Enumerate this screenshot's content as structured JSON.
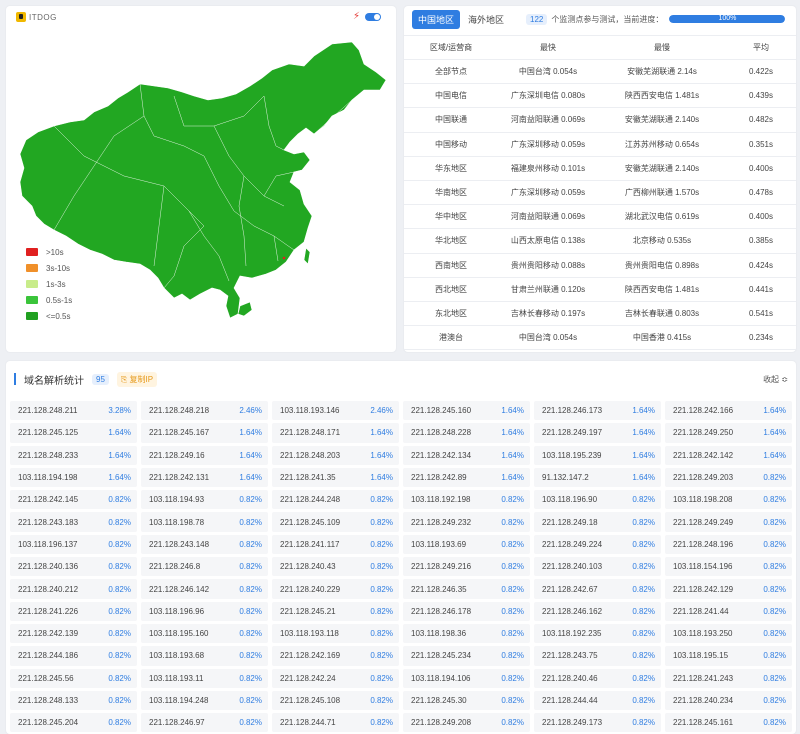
{
  "brand": {
    "name": "ITDOG"
  },
  "legend": [
    {
      "label": ">10s",
      "color": "#e02020"
    },
    {
      "label": "3s-10s",
      "color": "#f0902a"
    },
    {
      "label": "1s-3s",
      "color": "#c8ec8a"
    },
    {
      "label": "0.5s-1s",
      "color": "#3ac43a"
    },
    {
      "label": "<=0.5s",
      "color": "#20a020"
    }
  ],
  "map_fill_color": "#22a722",
  "stats": {
    "tabs": [
      "中国地区",
      "海外地区"
    ],
    "active_tab": "中国地区",
    "node_count": "122",
    "progress_text": "个监测点参与测试，当前进度：",
    "progress_label": "100%",
    "progress_value": 1.0,
    "columns": [
      "区域/运营商",
      "最快",
      "最慢",
      "平均"
    ],
    "rows": [
      [
        "全部节点",
        "中国台湾 0.054s",
        "安徽芜湖联通 2.14s",
        "0.422s"
      ],
      [
        "中国电信",
        "广东深圳电信 0.080s",
        "陕西西安电信 1.481s",
        "0.439s"
      ],
      [
        "中国联通",
        "河南益阳联通 0.069s",
        "安徽芜湖联通 2.140s",
        "0.482s"
      ],
      [
        "中国移动",
        "广东深圳移动 0.059s",
        "江苏苏州移动 0.654s",
        "0.351s"
      ],
      [
        "华东地区",
        "福建泉州移动 0.101s",
        "安徽芜湖联通 2.140s",
        "0.400s"
      ],
      [
        "华南地区",
        "广东深圳移动 0.059s",
        "广西柳州联通 1.570s",
        "0.478s"
      ],
      [
        "华中地区",
        "河南益阳联通 0.069s",
        "湖北武汉电信 0.619s",
        "0.400s"
      ],
      [
        "华北地区",
        "山西太原电信 0.138s",
        "北京移动 0.535s",
        "0.385s"
      ],
      [
        "西南地区",
        "贵州贵阳移动 0.088s",
        "贵州贵阳电信 0.898s",
        "0.424s"
      ],
      [
        "西北地区",
        "甘肃兰州联通 0.120s",
        "陕西西安电信 1.481s",
        "0.441s"
      ],
      [
        "东北地区",
        "吉林长春移动 0.197s",
        "吉林长春联通 0.803s",
        "0.541s"
      ],
      [
        "港澳台",
        "中国台湾 0.054s",
        "中国香港 0.415s",
        "0.234s"
      ]
    ]
  },
  "dns": {
    "title": "域名解析统计",
    "count": "95",
    "copy_label": "复制IP",
    "collapse_label": "收起 ≎",
    "entries": [
      [
        "221.128.248.211",
        "3.28%"
      ],
      [
        "221.128.248.218",
        "2.46%"
      ],
      [
        "103.118.193.146",
        "2.46%"
      ],
      [
        "221.128.245.160",
        "1.64%"
      ],
      [
        "221.128.246.173",
        "1.64%"
      ],
      [
        "221.128.242.166",
        "1.64%"
      ],
      [
        "221.128.245.125",
        "1.64%"
      ],
      [
        "221.128.245.167",
        "1.64%"
      ],
      [
        "221.128.248.171",
        "1.64%"
      ],
      [
        "221.128.248.228",
        "1.64%"
      ],
      [
        "221.128.249.197",
        "1.64%"
      ],
      [
        "221.128.249.250",
        "1.64%"
      ],
      [
        "221.128.248.233",
        "1.64%"
      ],
      [
        "221.128.249.16",
        "1.64%"
      ],
      [
        "221.128.248.203",
        "1.64%"
      ],
      [
        "221.128.242.134",
        "1.64%"
      ],
      [
        "103.118.195.239",
        "1.64%"
      ],
      [
        "221.128.242.142",
        "1.64%"
      ],
      [
        "103.118.194.198",
        "1.64%"
      ],
      [
        "221.128.242.131",
        "1.64%"
      ],
      [
        "221.128.241.35",
        "1.64%"
      ],
      [
        "221.128.242.89",
        "1.64%"
      ],
      [
        "91.132.147.2",
        "1.64%"
      ],
      [
        "221.128.249.203",
        "0.82%"
      ],
      [
        "221.128.242.145",
        "0.82%"
      ],
      [
        "103.118.194.93",
        "0.82%"
      ],
      [
        "221.128.244.248",
        "0.82%"
      ],
      [
        "103.118.192.198",
        "0.82%"
      ],
      [
        "103.118.196.90",
        "0.82%"
      ],
      [
        "103.118.198.208",
        "0.82%"
      ],
      [
        "221.128.243.183",
        "0.82%"
      ],
      [
        "103.118.198.78",
        "0.82%"
      ],
      [
        "221.128.245.109",
        "0.82%"
      ],
      [
        "221.128.249.232",
        "0.82%"
      ],
      [
        "221.128.249.18",
        "0.82%"
      ],
      [
        "221.128.249.249",
        "0.82%"
      ],
      [
        "103.118.196.137",
        "0.82%"
      ],
      [
        "221.128.243.148",
        "0.82%"
      ],
      [
        "221.128.241.117",
        "0.82%"
      ],
      [
        "103.118.193.69",
        "0.82%"
      ],
      [
        "221.128.249.224",
        "0.82%"
      ],
      [
        "221.128.248.196",
        "0.82%"
      ],
      [
        "221.128.240.136",
        "0.82%"
      ],
      [
        "221.128.246.8",
        "0.82%"
      ],
      [
        "221.128.240.43",
        "0.82%"
      ],
      [
        "221.128.249.216",
        "0.82%"
      ],
      [
        "221.128.240.103",
        "0.82%"
      ],
      [
        "103.118.154.196",
        "0.82%"
      ],
      [
        "221.128.240.212",
        "0.82%"
      ],
      [
        "221.128.246.142",
        "0.82%"
      ],
      [
        "221.128.240.229",
        "0.82%"
      ],
      [
        "221.128.246.35",
        "0.82%"
      ],
      [
        "221.128.242.67",
        "0.82%"
      ],
      [
        "221.128.242.129",
        "0.82%"
      ],
      [
        "221.128.241.226",
        "0.82%"
      ],
      [
        "103.118.196.96",
        "0.82%"
      ],
      [
        "221.128.245.21",
        "0.82%"
      ],
      [
        "221.128.246.178",
        "0.82%"
      ],
      [
        "221.128.246.162",
        "0.82%"
      ],
      [
        "221.128.241.44",
        "0.82%"
      ],
      [
        "221.128.242.139",
        "0.82%"
      ],
      [
        "103.118.195.160",
        "0.82%"
      ],
      [
        "103.118.193.118",
        "0.82%"
      ],
      [
        "103.118.198.36",
        "0.82%"
      ],
      [
        "103.118.192.235",
        "0.82%"
      ],
      [
        "103.118.193.250",
        "0.82%"
      ],
      [
        "221.128.244.186",
        "0.82%"
      ],
      [
        "103.118.193.68",
        "0.82%"
      ],
      [
        "221.128.242.169",
        "0.82%"
      ],
      [
        "221.128.245.234",
        "0.82%"
      ],
      [
        "221.128.243.75",
        "0.82%"
      ],
      [
        "103.118.195.15",
        "0.82%"
      ],
      [
        "221.128.245.56",
        "0.82%"
      ],
      [
        "103.118.193.11",
        "0.82%"
      ],
      [
        "221.128.242.24",
        "0.82%"
      ],
      [
        "103.118.194.106",
        "0.82%"
      ],
      [
        "221.128.240.46",
        "0.82%"
      ],
      [
        "221.128.241.243",
        "0.82%"
      ],
      [
        "221.128.248.133",
        "0.82%"
      ],
      [
        "103.118.194.248",
        "0.82%"
      ],
      [
        "221.128.245.108",
        "0.82%"
      ],
      [
        "221.128.245.30",
        "0.82%"
      ],
      [
        "221.128.244.44",
        "0.82%"
      ],
      [
        "221.128.240.234",
        "0.82%"
      ],
      [
        "221.128.245.204",
        "0.82%"
      ],
      [
        "221.128.246.97",
        "0.82%"
      ],
      [
        "221.128.244.71",
        "0.82%"
      ],
      [
        "221.128.249.208",
        "0.82%"
      ],
      [
        "221.128.249.173",
        "0.82%"
      ],
      [
        "221.128.245.161",
        "0.82%"
      ]
    ]
  }
}
